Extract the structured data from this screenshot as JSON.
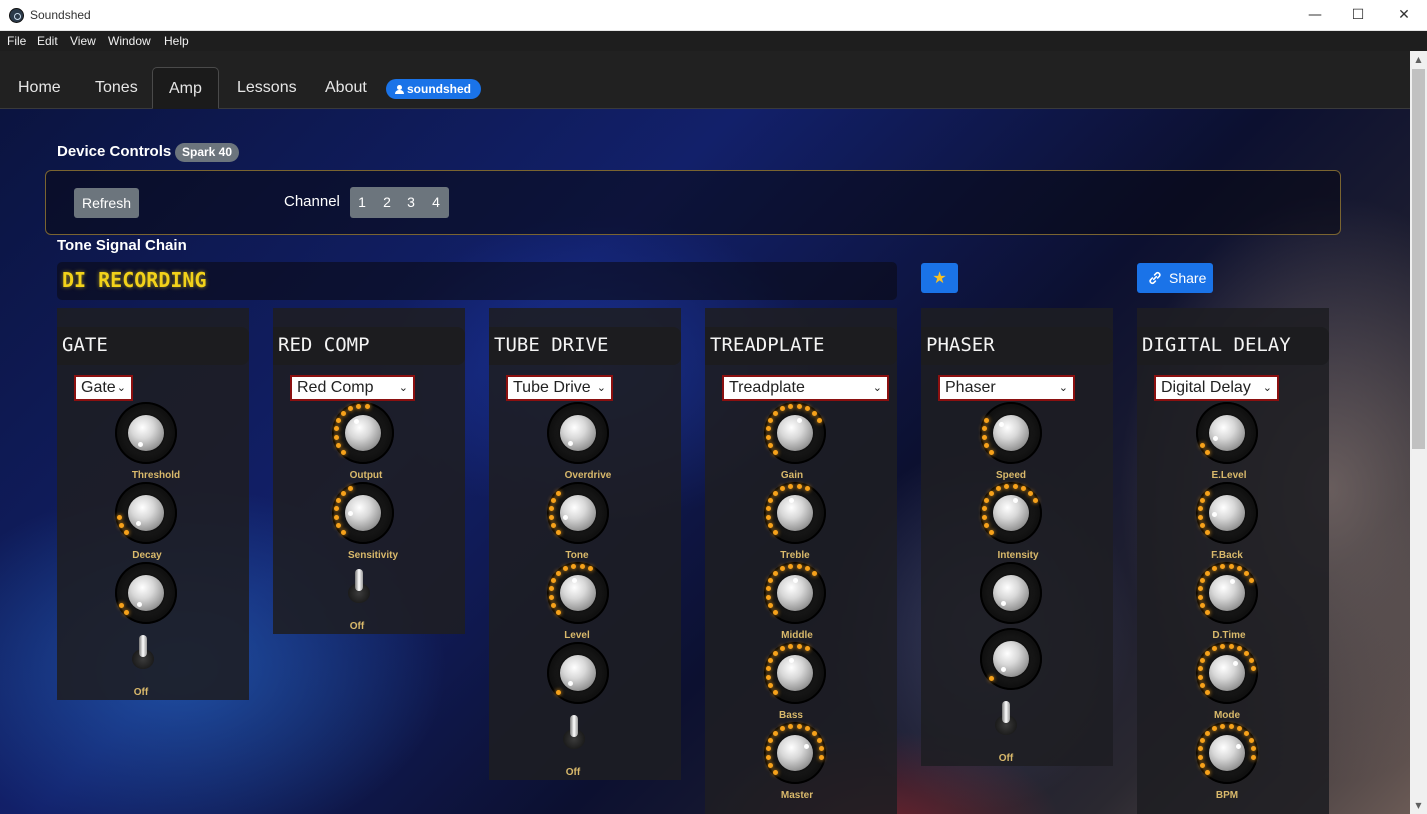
{
  "window": {
    "title": "Soundshed",
    "minimize": "—",
    "maximize": "☐",
    "close": "✕"
  },
  "menu": [
    "File",
    "Edit",
    "View",
    "Window",
    "Help"
  ],
  "nav": {
    "tabs": [
      "Home",
      "Tones",
      "Amp",
      "Lessons",
      "About"
    ],
    "active": "Amp",
    "user": "soundshed"
  },
  "device": {
    "heading": "Device Controls",
    "model": "Spark 40",
    "refresh": "Refresh",
    "channel_label": "Channel",
    "channels": [
      "1",
      "2",
      "3",
      "4"
    ]
  },
  "tone": {
    "heading": "Tone Signal Chain",
    "name": "DI RECORDING",
    "favorite_icon": "★",
    "share": "Share"
  },
  "pedals": [
    {
      "title": "GATE",
      "selected": "Gate",
      "knobs": [
        "Threshold",
        "Decay",
        ""
      ],
      "switch": "Off"
    },
    {
      "title": "RED COMP",
      "selected": "Red Comp",
      "knobs": [
        "Output",
        "Sensitivity"
      ],
      "switch": "Off"
    },
    {
      "title": "TUBE DRIVE",
      "selected": "Tube Drive",
      "knobs": [
        "Overdrive",
        "Tone",
        "Level",
        ""
      ],
      "switch": "Off"
    },
    {
      "title": "TREADPLATE",
      "selected": "Treadplate",
      "knobs": [
        "Gain",
        "Treble",
        "Middle",
        "Bass",
        "Master"
      ]
    },
    {
      "title": "PHASER",
      "selected": "Phaser",
      "knobs": [
        "Speed",
        "Intensity",
        "",
        ""
      ],
      "switch": "Off"
    },
    {
      "title": "DIGITAL DELAY",
      "selected": "Digital Delay",
      "knobs": [
        "E.Level",
        "F.Back",
        "D.Time",
        "Mode",
        "BPM"
      ]
    }
  ],
  "colors": {
    "accent": "#1a73e8",
    "led": "#f7a21b",
    "tone_name": "#f2d21a",
    "knob_label": "#d9b96b"
  }
}
